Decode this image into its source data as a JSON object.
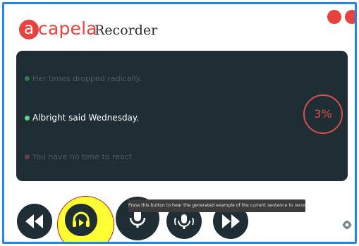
{
  "header": {
    "logo_initial": "a",
    "logo_rest": "capela",
    "title": "Recorder"
  },
  "sentences": [
    {
      "text": "Her times dropped radically.",
      "state": "done"
    },
    {
      "text": "Albright said Wednesday.",
      "state": "current"
    },
    {
      "text": "You have no time to react.",
      "state": "upcoming"
    }
  ],
  "progress": {
    "label": "3%",
    "value_percent": 3
  },
  "controls": {
    "tooltip": "Press this button to hear the generated example of the current sentence to record",
    "buttons": [
      {
        "id": "previous",
        "icon": "rewind-icon"
      },
      {
        "id": "listen",
        "icon": "headphones-play-icon",
        "highlighted": true
      },
      {
        "id": "record",
        "icon": "microphone-icon"
      },
      {
        "id": "play-recording",
        "icon": "microphone-playback-icon"
      },
      {
        "id": "next",
        "icon": "fast-forward-icon"
      }
    ],
    "settings_icon": "settings-icon"
  },
  "colors": {
    "brand": "#e8423f",
    "panel": "#1f2d35",
    "frame": "#1f86f0",
    "highlight": "#ffff33"
  }
}
